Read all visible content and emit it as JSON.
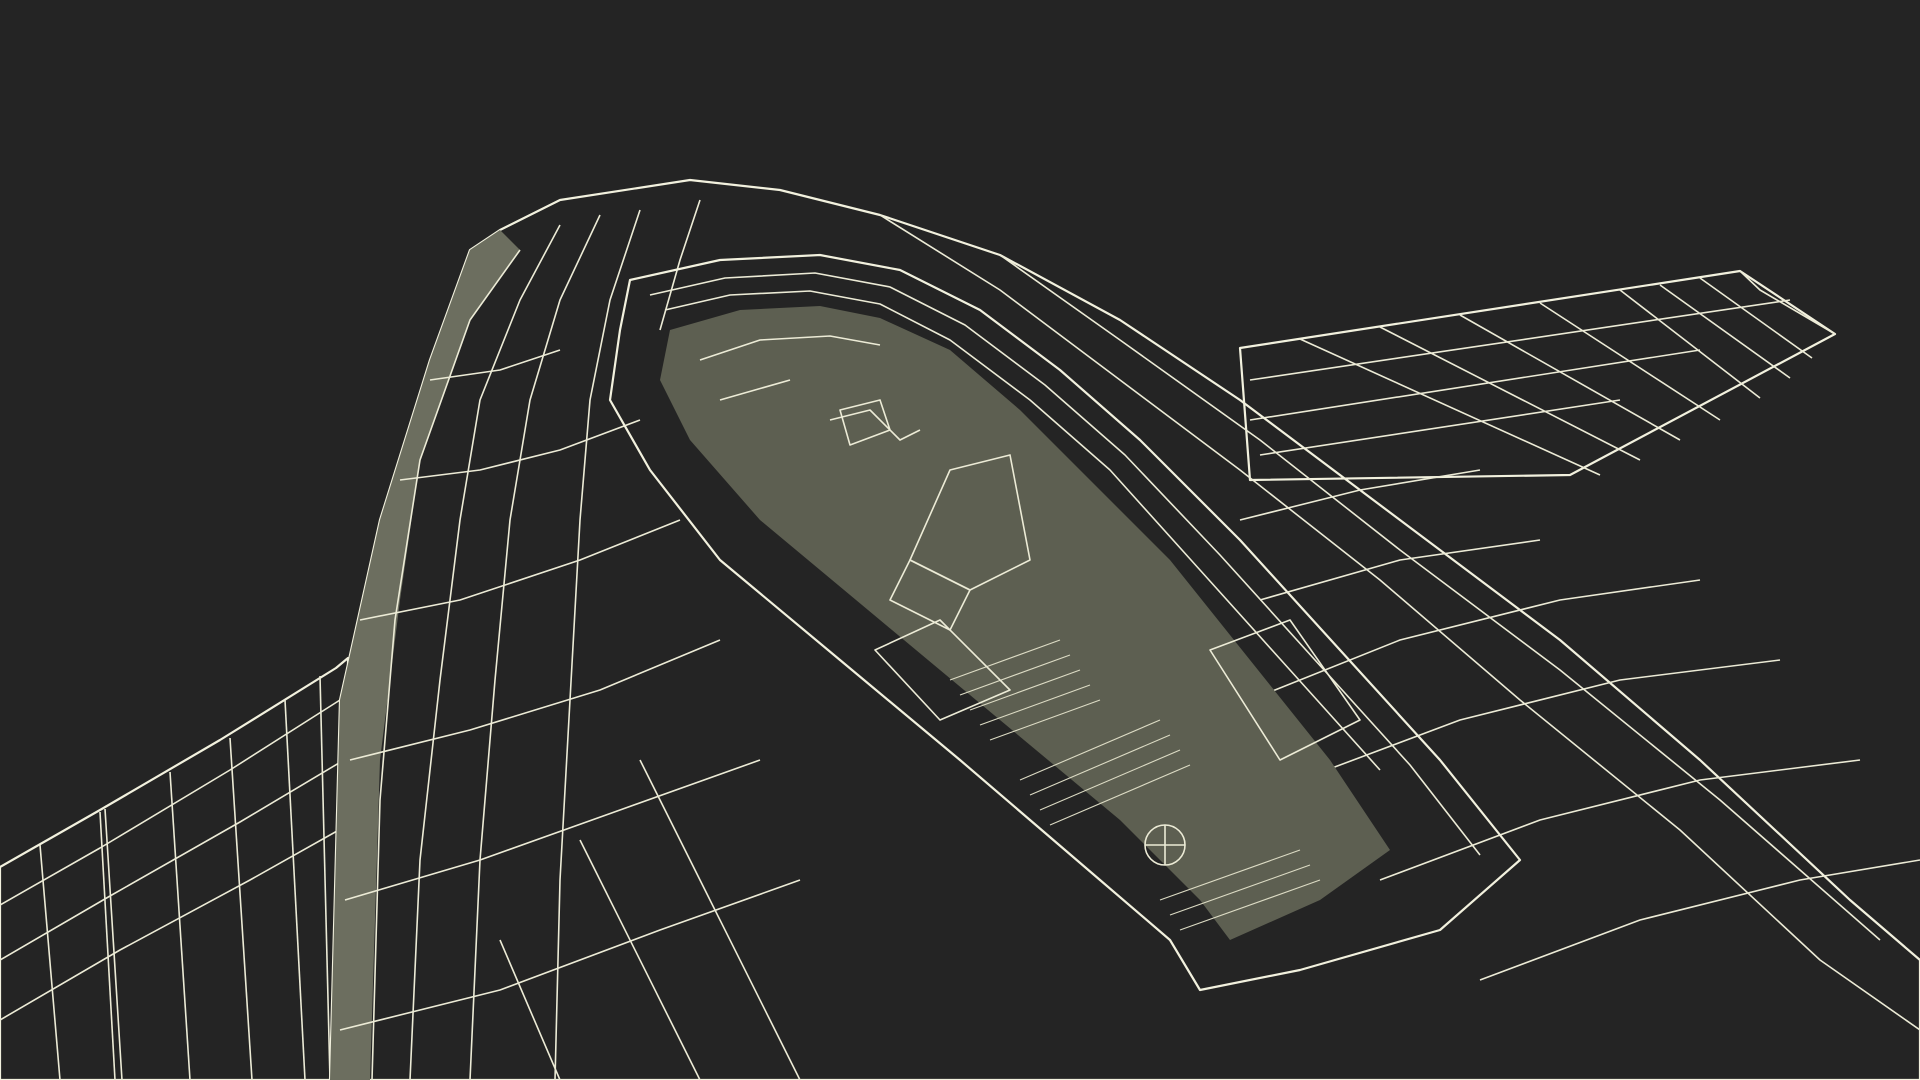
{
  "scene": {
    "subject": "aircraft-cockpit-wireframe",
    "colors": {
      "background": "#242424",
      "surface": "#757767",
      "surface_shadow": "#5f6153",
      "cockpit_floor": "#6b6d5e",
      "wireframe": "#ecebd6"
    }
  }
}
